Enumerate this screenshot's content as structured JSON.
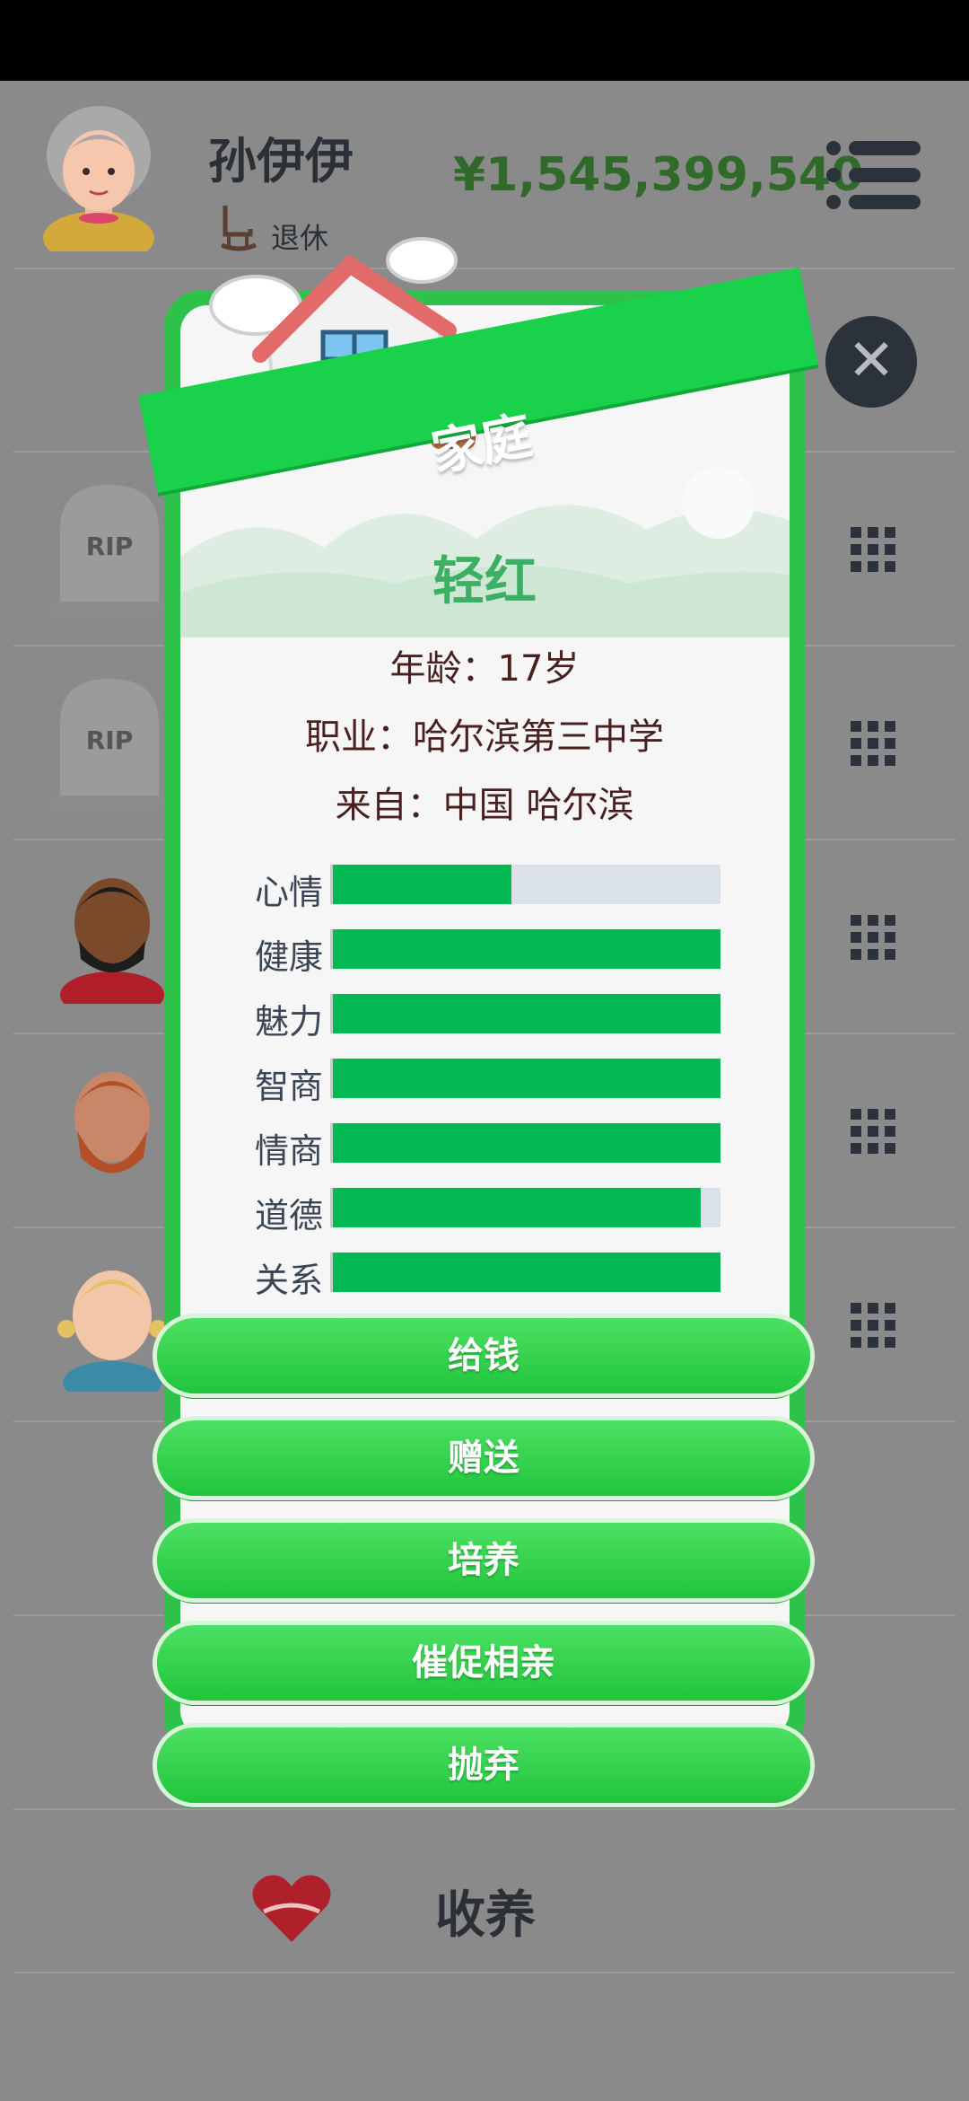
{
  "header": {
    "player_name": "孙伊伊",
    "status": "退休",
    "money": "¥1,545,399,540"
  },
  "modal": {
    "category": "家庭",
    "member_name": "轻红",
    "age": "年龄：17岁",
    "occupation": "职业：哈尔滨第三中学",
    "origin": "来自：中国 哈尔滨",
    "stats": [
      {
        "label": "心情",
        "level": 0.46
      },
      {
        "label": "健康",
        "level": 1.0
      },
      {
        "label": "魅力",
        "level": 1.0
      },
      {
        "label": "智商",
        "level": 1.0
      },
      {
        "label": "情商",
        "level": 1.0
      },
      {
        "label": "道德",
        "level": 0.95
      },
      {
        "label": "关系",
        "level": 1.0
      }
    ],
    "actions": [
      "给钱",
      "赠送",
      "培养",
      "催促相亲",
      "抛弃"
    ]
  },
  "list": {
    "rip_label": "RIP",
    "adopt_label": "收养"
  },
  "colors": {
    "accent_green": "#19d14b",
    "bar_green": "#04b954",
    "money_green": "#2f6a2a"
  }
}
